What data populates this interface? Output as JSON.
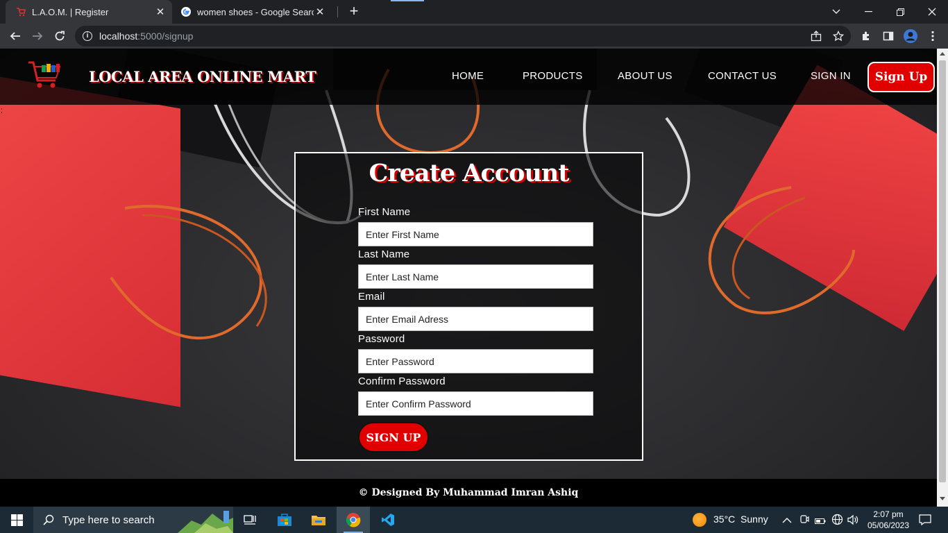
{
  "browser": {
    "tabs": [
      {
        "title": "L.A.O.M. | Register",
        "active": true
      },
      {
        "title": "women shoes - Google Search",
        "active": false
      }
    ],
    "url_host": "localhost",
    "url_path": ":5000/signup"
  },
  "site": {
    "brand": "LOCAL AREA ONLINE MART",
    "nav": [
      "HOME",
      "PRODUCTS",
      "ABOUT US",
      "CONTACT US",
      "SIGN IN"
    ],
    "signup_label": "Sign Up",
    "stray_char": ";"
  },
  "form": {
    "title": "Create Account",
    "fields": [
      {
        "label": "First Name",
        "placeholder": "Enter First Name"
      },
      {
        "label": "Last Name",
        "placeholder": "Enter Last Name"
      },
      {
        "label": "Email",
        "placeholder": "Enter Email Adress"
      },
      {
        "label": "Password",
        "placeholder": "Enter Password"
      },
      {
        "label": "Confirm Password",
        "placeholder": "Enter Confirm Password"
      }
    ],
    "submit_label": "SIGN UP"
  },
  "footer": {
    "text": "© Designed By Muhammad Imran Ashiq"
  },
  "taskbar": {
    "search_placeholder": "Type here to search",
    "weather": "35°C  Sunny",
    "time": "2:07 pm",
    "date": "05/06/2023"
  },
  "colors": {
    "brand_red": "#e00000",
    "chrome_dark": "#202124",
    "chrome_toolbar": "#35363a"
  }
}
